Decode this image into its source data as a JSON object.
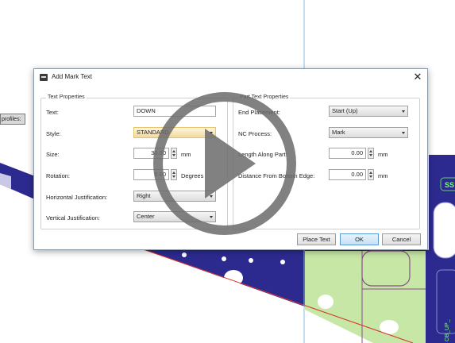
{
  "background": {
    "side_label": "profiles:",
    "callout": "SS",
    "part_label": "OB_UP_"
  },
  "dialog": {
    "title": "Add Mark Text",
    "close_glyph": "✕",
    "text_properties": {
      "group_title": "Text Properties",
      "text_label": "Text:",
      "text_value": "DOWN",
      "style_label": "Style:",
      "style_value": "STANDARD",
      "size_label": "Size:",
      "size_value": "30.00",
      "size_unit": "mm",
      "rotation_label": "Rotation:",
      "rotation_value": "0.00",
      "rotation_unit": "Degrees",
      "hjust_label": "Horizontal Justification:",
      "hjust_value": "Right",
      "vjust_label": "Vertical Justification:",
      "vjust_value": "Center"
    },
    "part_text_properties": {
      "group_title": "Part Text Properties",
      "end_placement_label": "End Placement:",
      "end_placement_value": "Start (Up)",
      "nc_process_label": "NC Process:",
      "nc_process_value": "Mark",
      "length_label": "Length Along Part:",
      "length_value": "0.00",
      "length_unit": "mm",
      "distance_label": "Distance From Bottom Edge:",
      "distance_value": "0.00",
      "distance_unit": "mm"
    },
    "buttons": {
      "place_text": "Place Text",
      "ok": "OK",
      "cancel": "Cancel"
    }
  },
  "colors": {
    "plate_blue": "#2d2a8f",
    "part_green": "#c7e7a6",
    "edge_red": "#d9322a",
    "play_gray": "#6b6b6b"
  },
  "icons": {
    "play": "play-icon",
    "app": "app-icon",
    "close": "close-icon"
  }
}
